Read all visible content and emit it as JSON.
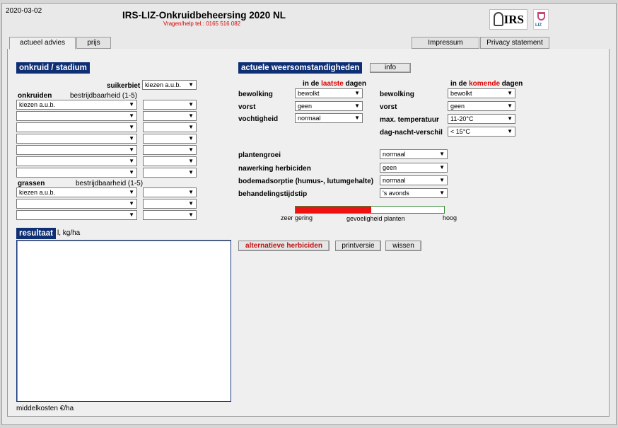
{
  "header": {
    "date": "2020-03-02",
    "title": "IRS-LIZ-Onkruidbeheersing 2020 NL",
    "helpline": "Vragen/help tel.: 0165 516 082",
    "logo_irs": "IRS",
    "logo_liz": "LIZ"
  },
  "tabs": {
    "actueel": "actueel advies",
    "prijs": "prijs",
    "impressum": "Impressum",
    "privacy": "Privacy statement"
  },
  "left": {
    "section_title": "onkruid / stadium",
    "crop_label": "suikerbiet",
    "crop_value": "kiezen a.u.b.",
    "weeds_label": "onkruiden",
    "weeds_diff_label": "bestrijdbaarheid (1-5)",
    "weeds_first": "kiezen a.u.b.",
    "grasses_label": "grassen",
    "grasses_diff_label": "bestrijdbaarheid (1-5)",
    "grasses_first": "kiezen a.u.b.",
    "result_title": "resultaat",
    "result_unit": "l, kg/ha",
    "cost_label": "middelkosten €/ha"
  },
  "weather": {
    "section_title": "actuele weersomstandigheden",
    "info_button": "info",
    "past_prefix": "in de ",
    "past_highlight": "laatste",
    "past_suffix": " dagen",
    "future_prefix": "in de ",
    "future_highlight": "komende",
    "future_suffix": " dagen",
    "past": {
      "bewolking_label": "bewolking",
      "bewolking_value": "bewolkt",
      "vorst_label": "vorst",
      "vorst_value": "geen",
      "vochtigheid_label": "vochtigheid",
      "vochtigheid_value": "normaal"
    },
    "future": {
      "bewolking_label": "bewolking",
      "bewolking_value": "bewolkt",
      "vorst_label": "vorst",
      "vorst_value": "geen",
      "maxtemp_label": "max. temperatuur",
      "maxtemp_value": "11-20°C",
      "dagnacht_label": "dag-nacht-verschil",
      "dagnacht_value": "< 15°C"
    }
  },
  "conditions": {
    "plantengroei_label": "plantengroei",
    "plantengroei_value": "normaal",
    "nawerking_label": "nawerking herbiciden",
    "nawerking_value": "geen",
    "bodem_label": "bodemadsorptie (humus-, lutumgehalte)",
    "bodem_value": "normaal",
    "tijdstip_label": "behandelingstijdstip",
    "tijdstip_value": "'s avonds"
  },
  "sensitivity": {
    "label_low": "zeer gering",
    "label_mid": "gevoeligheid planten",
    "label_high": "hoog",
    "level": 0.51,
    "fill_color": "#ee1111"
  },
  "actions": {
    "alternatives": "alternatieve herbiciden",
    "print": "printversie",
    "clear": "wissen"
  }
}
